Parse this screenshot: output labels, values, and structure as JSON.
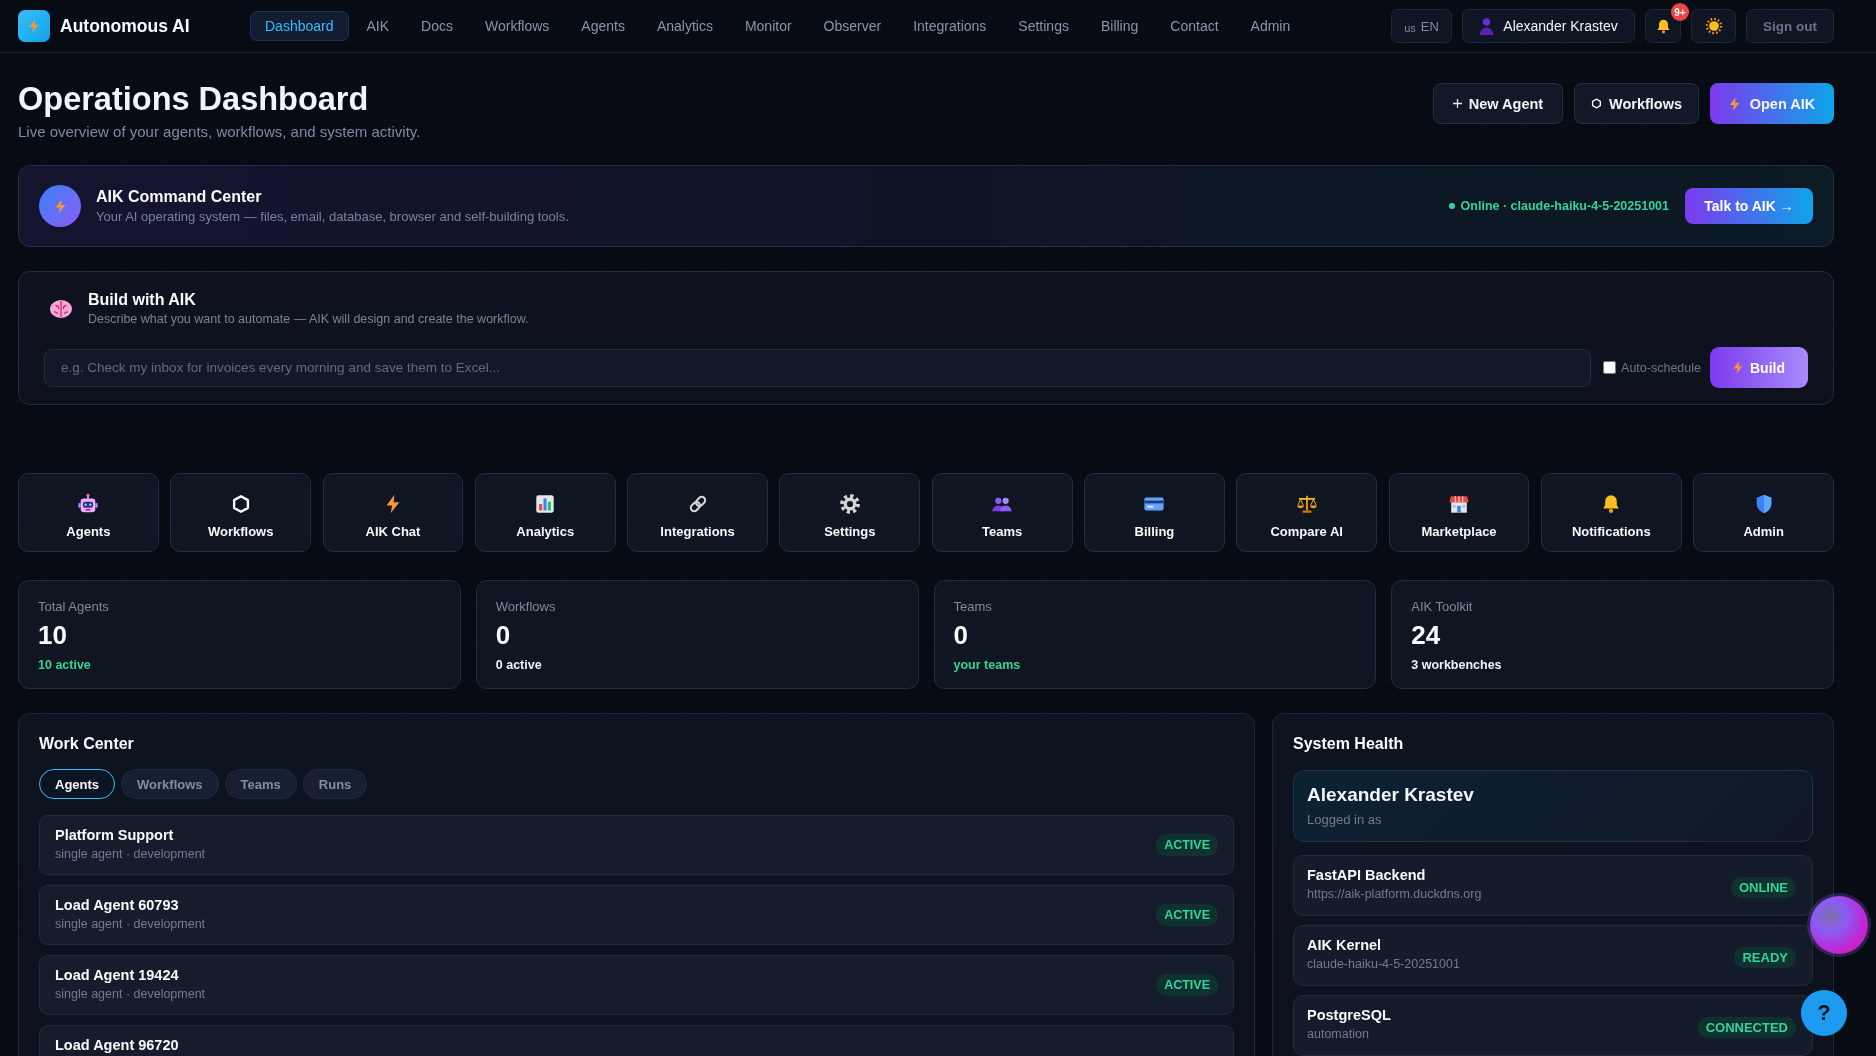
{
  "brand": {
    "name": "Autonomous AI"
  },
  "nav": [
    {
      "label": "Dashboard",
      "selected": true
    },
    {
      "label": "AIK",
      "selected": false
    },
    {
      "label": "Docs",
      "selected": false
    },
    {
      "label": "Workflows",
      "selected": false
    },
    {
      "label": "Agents",
      "selected": false
    },
    {
      "label": "Analytics",
      "selected": false
    },
    {
      "label": "Monitor",
      "selected": false
    },
    {
      "label": "Observer",
      "selected": false
    },
    {
      "label": "Integrations",
      "selected": false
    },
    {
      "label": "Settings",
      "selected": false
    },
    {
      "label": "Billing",
      "selected": false
    },
    {
      "label": "Contact",
      "selected": false
    },
    {
      "label": "Admin",
      "selected": false
    }
  ],
  "account_bar": {
    "language": {
      "flag": "us",
      "label": "EN"
    },
    "user": {
      "name": "Alexander Krastev"
    },
    "notifications": {
      "badge": "9+"
    },
    "sign_out": "Sign out"
  },
  "header": {
    "title": "Operations Dashboard",
    "subtitle": "Live overview of your agents, workflows, and system activity.",
    "buttons": [
      {
        "kind": "add",
        "label": "New Agent"
      },
      {
        "kind": "workflows",
        "label": "Workflows"
      },
      {
        "kind": "launch",
        "label": "Open AIK"
      }
    ]
  },
  "command_center": {
    "title": "AIK Command Center",
    "description": "Your AI operating system — files, email, database, browser and self-building tools.",
    "online": true,
    "status": "Online · claude-haiku-4-5-20251001",
    "button": "Talk to AIK →"
  },
  "build": {
    "title": "Build with AIK",
    "description": "Describe what you want to automate — AIK will design and create the workflow.",
    "input": {
      "placeholder": "e.g. Check my inbox for invoices every morning and save them to Excel..."
    },
    "auto_schedule": {
      "label": "Auto-schedule",
      "checked": false
    },
    "button": "Build"
  },
  "shortcuts": [
    {
      "label": "Agents"
    },
    {
      "label": "Workflows"
    },
    {
      "label": "AIK Chat"
    },
    {
      "label": "Analytics"
    },
    {
      "label": "Integrations"
    },
    {
      "label": "Settings"
    },
    {
      "label": "Teams"
    },
    {
      "label": "Billing"
    },
    {
      "label": "Compare AI"
    },
    {
      "label": "Marketplace"
    },
    {
      "label": "Notifications"
    },
    {
      "label": "Admin"
    }
  ],
  "stats": [
    {
      "label": "Total Agents",
      "value": "10",
      "note": "10 active",
      "accent": true
    },
    {
      "label": "Workflows",
      "value": "0",
      "note": "0 active",
      "accent": false
    },
    {
      "label": "Teams",
      "value": "0",
      "note": "your teams",
      "accent": true
    },
    {
      "label": "AIK Toolkit",
      "value": "24",
      "note": "3 workbenches",
      "accent": false
    }
  ],
  "work_center": {
    "title": "Work Center",
    "tabs": [
      {
        "label": "Agents",
        "selected": true
      },
      {
        "label": "Workflows",
        "selected": false
      },
      {
        "label": "Teams",
        "selected": false
      },
      {
        "label": "Runs",
        "selected": false
      }
    ],
    "items": [
      {
        "name": "Platform Support",
        "meta": "single agent · development",
        "status": "ACTIVE"
      },
      {
        "name": "Load Agent 60793",
        "meta": "single agent · development",
        "status": "ACTIVE"
      },
      {
        "name": "Load Agent 19424",
        "meta": "single agent · development",
        "status": "ACTIVE"
      },
      {
        "name": "Load Agent 96720"
      }
    ]
  },
  "system_health": {
    "title": "System Health",
    "user": {
      "name": "Alexander Krastev",
      "caption": "Logged in as"
    },
    "services": [
      {
        "name": "FastAPI Backend",
        "detail": "https://aik-platform.duckdns.org",
        "status": "ONLINE"
      },
      {
        "name": "AIK Kernel",
        "detail": "claude-haiku-4-5-20251001",
        "status": "READY"
      },
      {
        "name": "PostgreSQL",
        "detail": "automation",
        "status": "CONNECTED"
      }
    ]
  },
  "help_button": {
    "label": "?"
  }
}
